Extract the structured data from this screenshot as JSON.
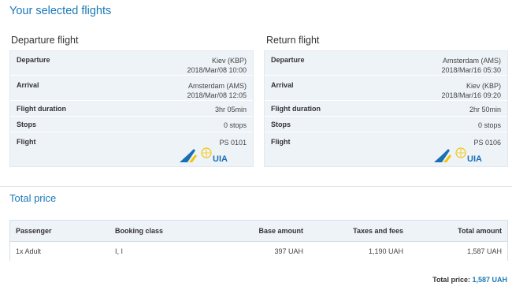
{
  "page": {
    "title": "Your selected flights"
  },
  "departure": {
    "heading": "Departure flight",
    "rows": [
      {
        "label": "Departure",
        "line1": "Kiev (KBP)",
        "line2": "2018/Mar/08 10:00"
      },
      {
        "label": "Arrival",
        "line1": "Amsterdam (AMS)",
        "line2": "2018/Mar/08 12:05"
      },
      {
        "label": "Flight duration",
        "line1": "3hr 05min"
      },
      {
        "label": "Stops",
        "line1": "0 stops"
      },
      {
        "label": "Flight",
        "line1": "PS 0101"
      }
    ],
    "airline_logo": "UIA"
  },
  "return": {
    "heading": "Return flight",
    "rows": [
      {
        "label": "Departure",
        "line1": "Amsterdam (AMS)",
        "line2": "2018/Mar/16 05:30"
      },
      {
        "label": "Arrival",
        "line1": "Kiev (KBP)",
        "line2": "2018/Mar/16 09:20"
      },
      {
        "label": "Flight duration",
        "line1": "2hr 50min"
      },
      {
        "label": "Stops",
        "line1": "0 stops"
      },
      {
        "label": "Flight",
        "line1": "PS 0106"
      }
    ],
    "airline_logo": "UIA"
  },
  "total": {
    "heading": "Total price",
    "columns": [
      "Passenger",
      "Booking class",
      "Base amount",
      "Taxes and fees",
      "Total amount"
    ],
    "row": {
      "passenger": "1x Adult",
      "booking_class": "I, I",
      "base_amount": "397 UAH",
      "taxes": "1,190 UAH",
      "total_amount": "1,587 UAH"
    },
    "summary_label": "Total price:",
    "summary_value": "1,587 UAH"
  },
  "colors": {
    "accent": "#1a78b8",
    "card_bg": "#eef3f8",
    "logo_yellow": "#f5c400"
  },
  "icons": {
    "airline": "uia-logo"
  }
}
